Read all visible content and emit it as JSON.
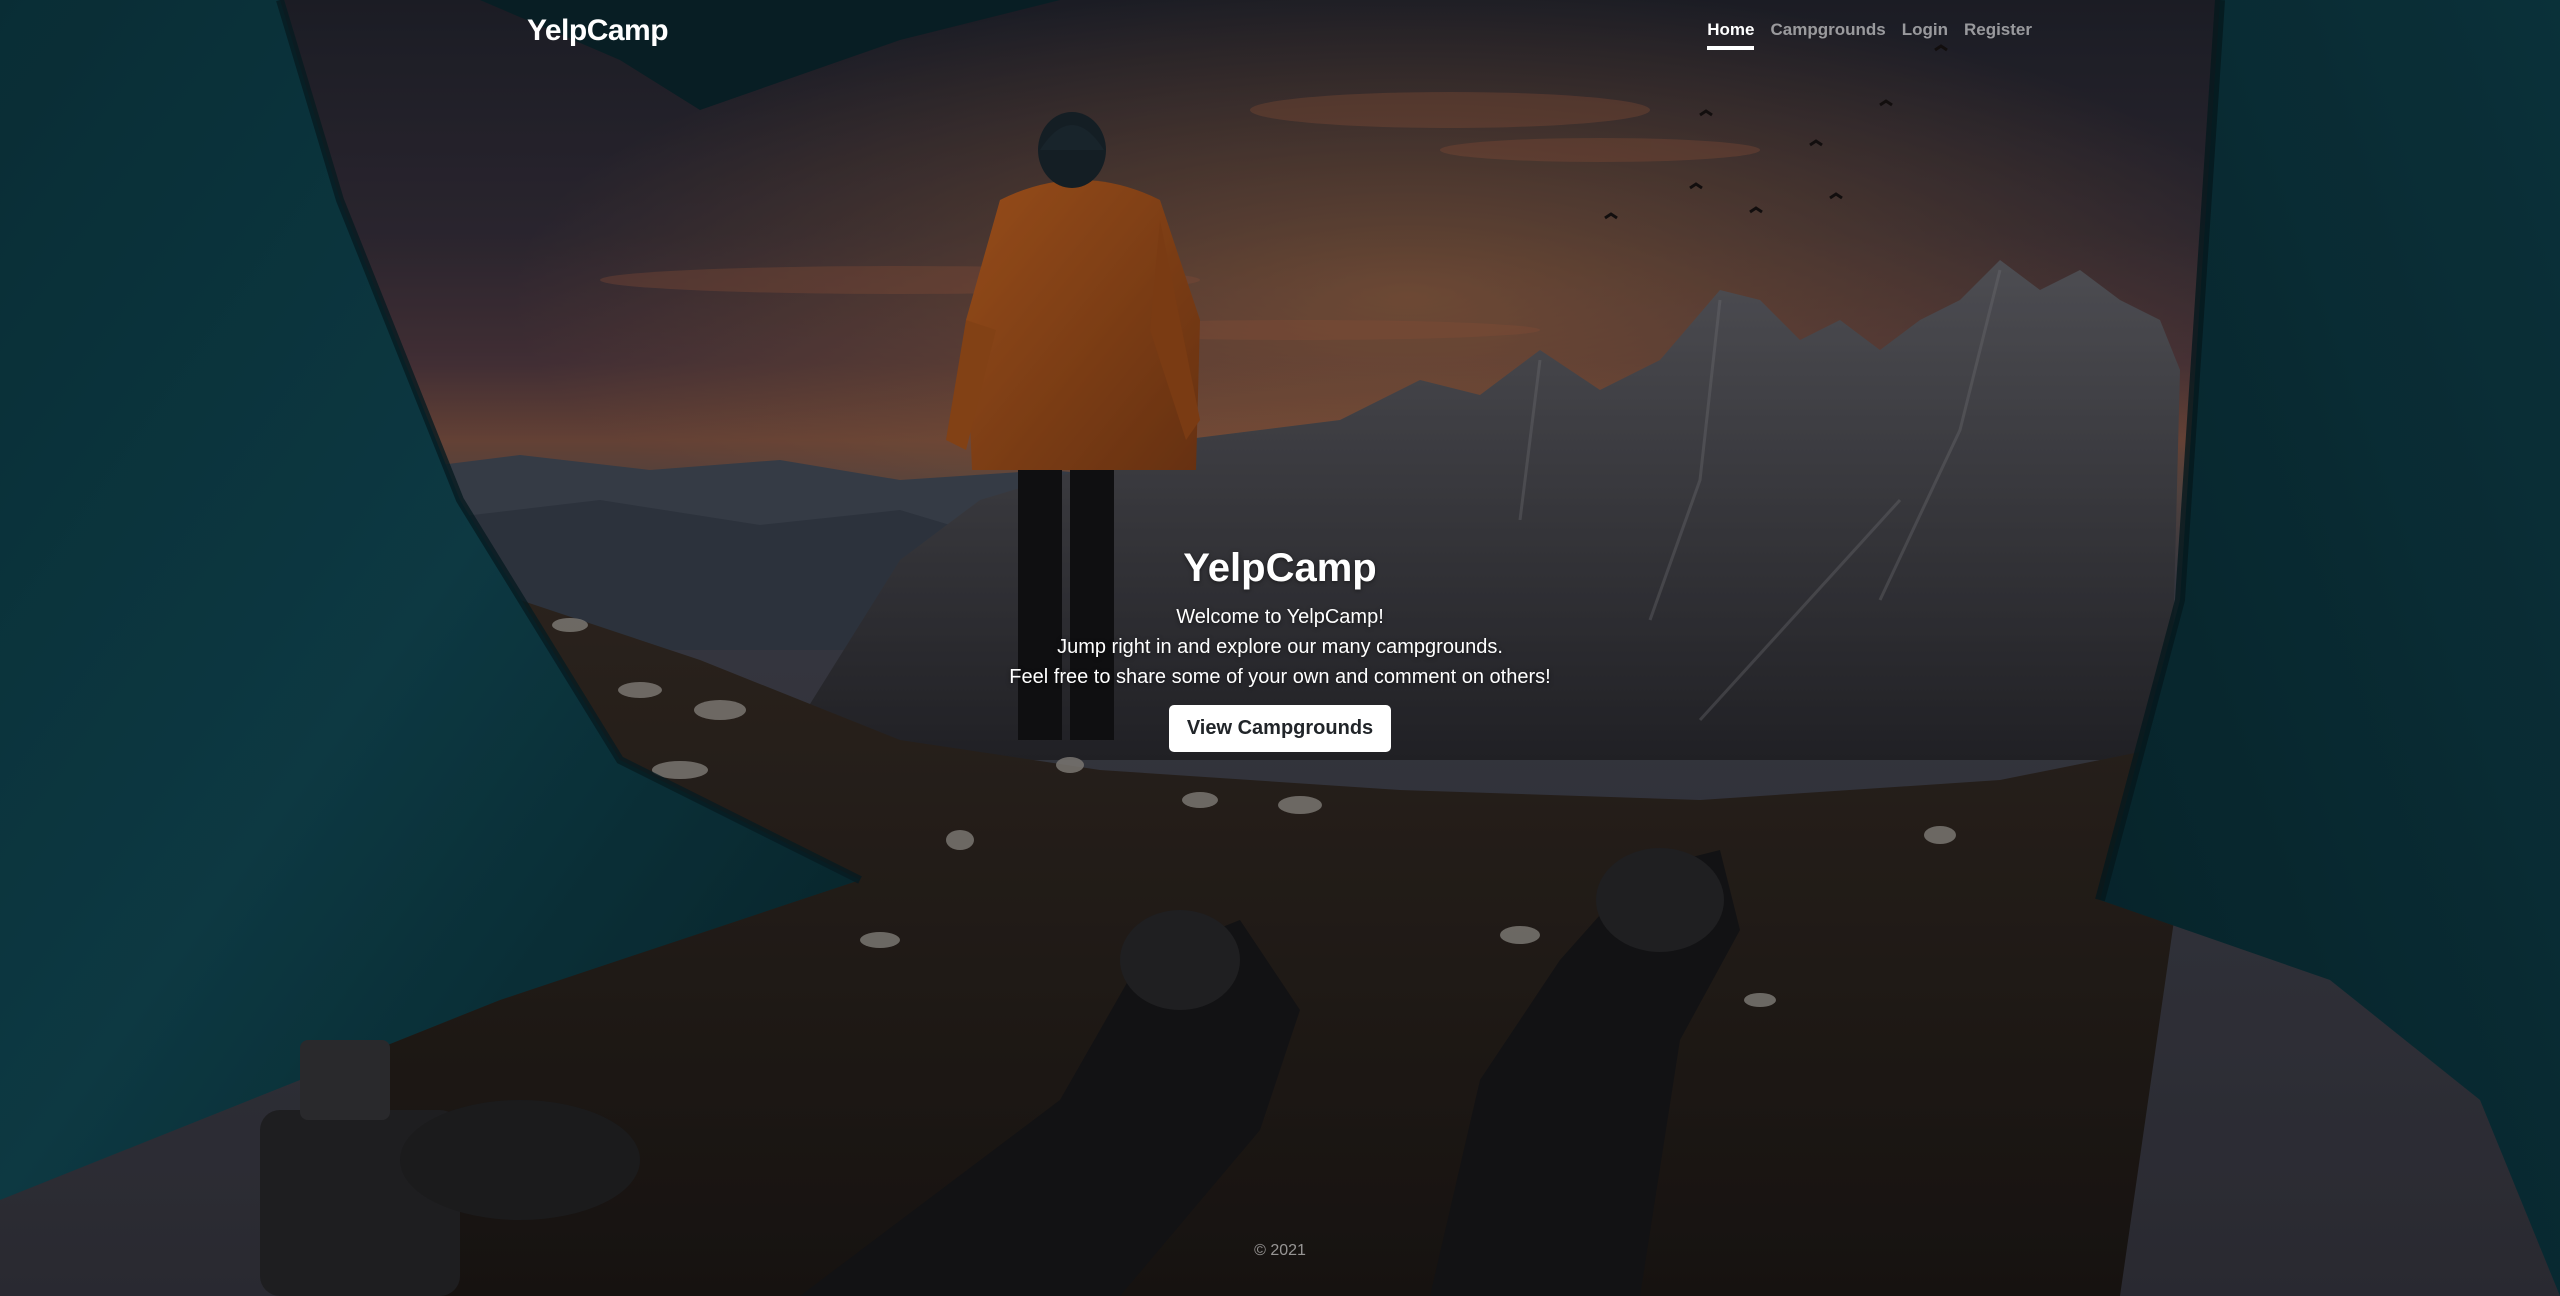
{
  "navbar": {
    "brand": "YelpCamp",
    "links": [
      {
        "label": "Home",
        "active": true
      },
      {
        "label": "Campgrounds",
        "active": false
      },
      {
        "label": "Login",
        "active": false
      },
      {
        "label": "Register",
        "active": false
      }
    ]
  },
  "hero": {
    "title": "YelpCamp",
    "lines": [
      "Welcome to YelpCamp!",
      "Jump right in and explore our many campgrounds.",
      "Feel free to share some of your own and comment on others!"
    ],
    "cta_label": "View Campgrounds"
  },
  "footer": {
    "text": "© 2021"
  },
  "colors": {
    "tent": "#0e4652",
    "jacket": "#c4601f",
    "sky_glow": "#c8763f",
    "ground": "#3a2e28"
  }
}
